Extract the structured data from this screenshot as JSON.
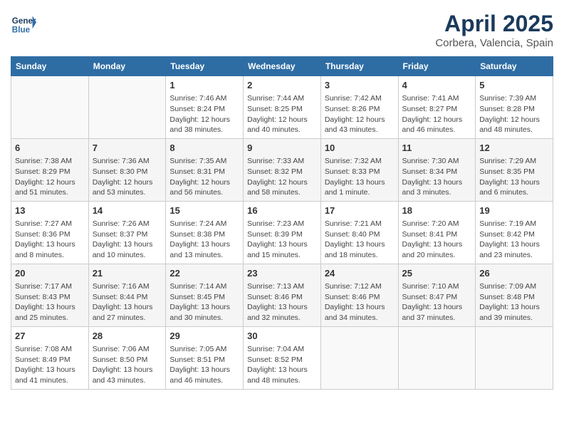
{
  "header": {
    "logo_line1": "General",
    "logo_line2": "Blue",
    "title": "April 2025",
    "subtitle": "Corbera, Valencia, Spain"
  },
  "days_of_week": [
    "Sunday",
    "Monday",
    "Tuesday",
    "Wednesday",
    "Thursday",
    "Friday",
    "Saturday"
  ],
  "weeks": [
    [
      {
        "day": null
      },
      {
        "day": null
      },
      {
        "day": "1",
        "sunrise": "7:46 AM",
        "sunset": "8:24 PM",
        "daylight": "12 hours and 38 minutes."
      },
      {
        "day": "2",
        "sunrise": "7:44 AM",
        "sunset": "8:25 PM",
        "daylight": "12 hours and 40 minutes."
      },
      {
        "day": "3",
        "sunrise": "7:42 AM",
        "sunset": "8:26 PM",
        "daylight": "12 hours and 43 minutes."
      },
      {
        "day": "4",
        "sunrise": "7:41 AM",
        "sunset": "8:27 PM",
        "daylight": "12 hours and 46 minutes."
      },
      {
        "day": "5",
        "sunrise": "7:39 AM",
        "sunset": "8:28 PM",
        "daylight": "12 hours and 48 minutes."
      }
    ],
    [
      {
        "day": "6",
        "sunrise": "7:38 AM",
        "sunset": "8:29 PM",
        "daylight": "12 hours and 51 minutes."
      },
      {
        "day": "7",
        "sunrise": "7:36 AM",
        "sunset": "8:30 PM",
        "daylight": "12 hours and 53 minutes."
      },
      {
        "day": "8",
        "sunrise": "7:35 AM",
        "sunset": "8:31 PM",
        "daylight": "12 hours and 56 minutes."
      },
      {
        "day": "9",
        "sunrise": "7:33 AM",
        "sunset": "8:32 PM",
        "daylight": "12 hours and 58 minutes."
      },
      {
        "day": "10",
        "sunrise": "7:32 AM",
        "sunset": "8:33 PM",
        "daylight": "13 hours and 1 minute."
      },
      {
        "day": "11",
        "sunrise": "7:30 AM",
        "sunset": "8:34 PM",
        "daylight": "13 hours and 3 minutes."
      },
      {
        "day": "12",
        "sunrise": "7:29 AM",
        "sunset": "8:35 PM",
        "daylight": "13 hours and 6 minutes."
      }
    ],
    [
      {
        "day": "13",
        "sunrise": "7:27 AM",
        "sunset": "8:36 PM",
        "daylight": "13 hours and 8 minutes."
      },
      {
        "day": "14",
        "sunrise": "7:26 AM",
        "sunset": "8:37 PM",
        "daylight": "13 hours and 10 minutes."
      },
      {
        "day": "15",
        "sunrise": "7:24 AM",
        "sunset": "8:38 PM",
        "daylight": "13 hours and 13 minutes."
      },
      {
        "day": "16",
        "sunrise": "7:23 AM",
        "sunset": "8:39 PM",
        "daylight": "13 hours and 15 minutes."
      },
      {
        "day": "17",
        "sunrise": "7:21 AM",
        "sunset": "8:40 PM",
        "daylight": "13 hours and 18 minutes."
      },
      {
        "day": "18",
        "sunrise": "7:20 AM",
        "sunset": "8:41 PM",
        "daylight": "13 hours and 20 minutes."
      },
      {
        "day": "19",
        "sunrise": "7:19 AM",
        "sunset": "8:42 PM",
        "daylight": "13 hours and 23 minutes."
      }
    ],
    [
      {
        "day": "20",
        "sunrise": "7:17 AM",
        "sunset": "8:43 PM",
        "daylight": "13 hours and 25 minutes."
      },
      {
        "day": "21",
        "sunrise": "7:16 AM",
        "sunset": "8:44 PM",
        "daylight": "13 hours and 27 minutes."
      },
      {
        "day": "22",
        "sunrise": "7:14 AM",
        "sunset": "8:45 PM",
        "daylight": "13 hours and 30 minutes."
      },
      {
        "day": "23",
        "sunrise": "7:13 AM",
        "sunset": "8:46 PM",
        "daylight": "13 hours and 32 minutes."
      },
      {
        "day": "24",
        "sunrise": "7:12 AM",
        "sunset": "8:46 PM",
        "daylight": "13 hours and 34 minutes."
      },
      {
        "day": "25",
        "sunrise": "7:10 AM",
        "sunset": "8:47 PM",
        "daylight": "13 hours and 37 minutes."
      },
      {
        "day": "26",
        "sunrise": "7:09 AM",
        "sunset": "8:48 PM",
        "daylight": "13 hours and 39 minutes."
      }
    ],
    [
      {
        "day": "27",
        "sunrise": "7:08 AM",
        "sunset": "8:49 PM",
        "daylight": "13 hours and 41 minutes."
      },
      {
        "day": "28",
        "sunrise": "7:06 AM",
        "sunset": "8:50 PM",
        "daylight": "13 hours and 43 minutes."
      },
      {
        "day": "29",
        "sunrise": "7:05 AM",
        "sunset": "8:51 PM",
        "daylight": "13 hours and 46 minutes."
      },
      {
        "day": "30",
        "sunrise": "7:04 AM",
        "sunset": "8:52 PM",
        "daylight": "13 hours and 48 minutes."
      },
      {
        "day": null
      },
      {
        "day": null
      },
      {
        "day": null
      }
    ]
  ]
}
